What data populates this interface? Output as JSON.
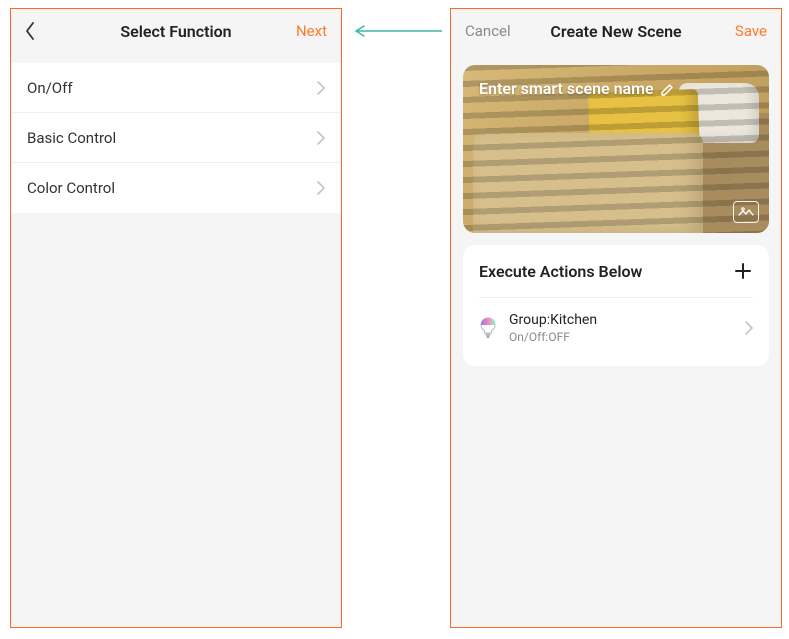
{
  "left_screen": {
    "title": "Select Function",
    "next_label": "Next",
    "items": [
      {
        "label": "On/Off"
      },
      {
        "label": "Basic Control"
      },
      {
        "label": "Color Control"
      }
    ]
  },
  "right_screen": {
    "cancel_label": "Cancel",
    "title": "Create New Scene",
    "save_label": "Save",
    "scene_name_placeholder": "Enter smart scene name",
    "actions_header": "Execute Actions Below",
    "action": {
      "title": "Group:Kitchen",
      "subtitle": "On/Off:OFF"
    }
  },
  "colors": {
    "accent": "#ff7a2d",
    "muted": "#8a8a8a"
  }
}
